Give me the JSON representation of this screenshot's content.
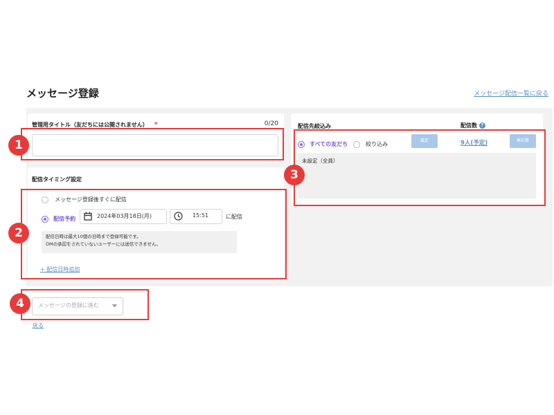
{
  "header": {
    "title": "メッセージ登録",
    "back_to_list": "メッセージ配信一覧に戻る"
  },
  "admin_title": {
    "label": "管理用タイトル（友だちには公開されません）",
    "required_mark": "*",
    "counter": "0/20",
    "value": ""
  },
  "timing": {
    "label": "配信タイミング設定",
    "option_immediate": "メッセージ登録後すぐに配信",
    "option_scheduled": "配信予約",
    "date_value": "2024年03月18日(月)",
    "time_value": "15:51",
    "suffix": "に配信",
    "note_line1": "配信日時は最大10個の日時まで登録可能です。",
    "note_line2": "DMの承認をされていないユーザーには送信できません。",
    "add_link": "+ 配信日時追加"
  },
  "targeting": {
    "label": "配信先絞込み",
    "option_all": "すべての友だち",
    "option_filter": "絞り込み",
    "setting_button": "設定",
    "summary": "未設定（全員）"
  },
  "delivery_count": {
    "label": "配信数",
    "help_icon": "?",
    "value": "9人(予定)",
    "recalc_button": "再計算"
  },
  "footer": {
    "proceed_button": "メッセージの登録に進む",
    "back_link": "戻る"
  },
  "annotations": {
    "badge1": "1",
    "badge2": "2",
    "badge3": "3",
    "badge4": "4",
    "highlight_color": "#e83a3a"
  },
  "colors": {
    "accent_purple": "#8b6bd8",
    "link_blue": "#5b8fc7",
    "disabled_button": "#a9c8ea"
  }
}
